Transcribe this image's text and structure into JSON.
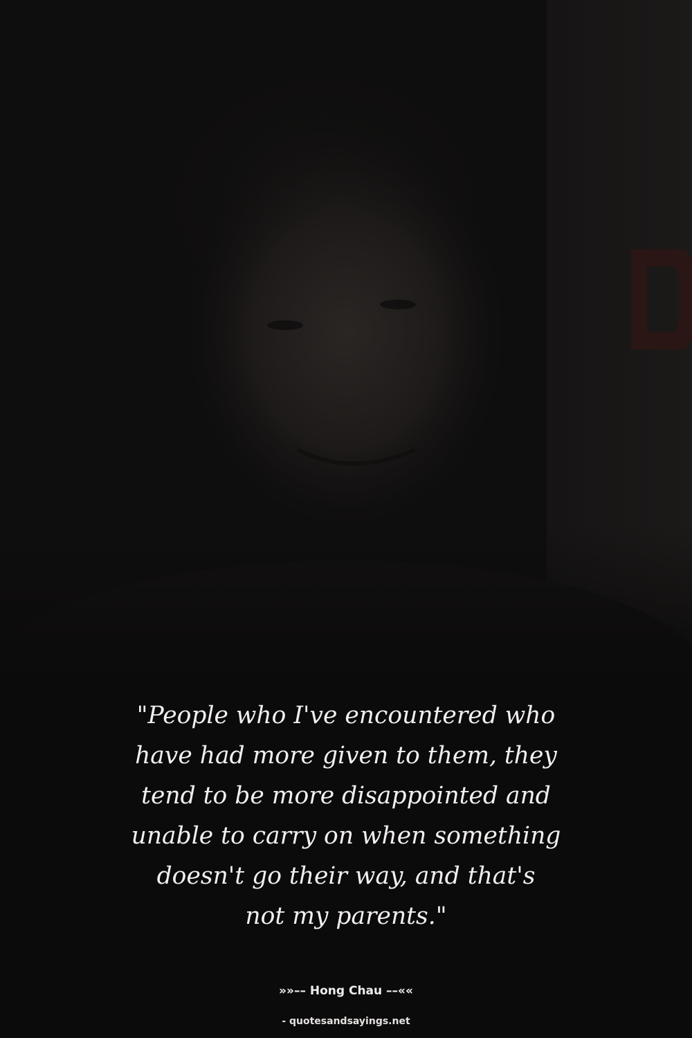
{
  "quote": {
    "text": "\"People who I've encountered who\nhave had more given to them, they\ntend to be more disappointed and\nunable to carry on when something\ndoesn't go their way, and that's\nnot my parents.\""
  },
  "author": {
    "line": "»»–– Hong Chau ––««"
  },
  "source": {
    "label": "- quotesandsayings.net"
  },
  "colors": {
    "background": "#0c0b0b",
    "text": "#f2f0ee"
  }
}
